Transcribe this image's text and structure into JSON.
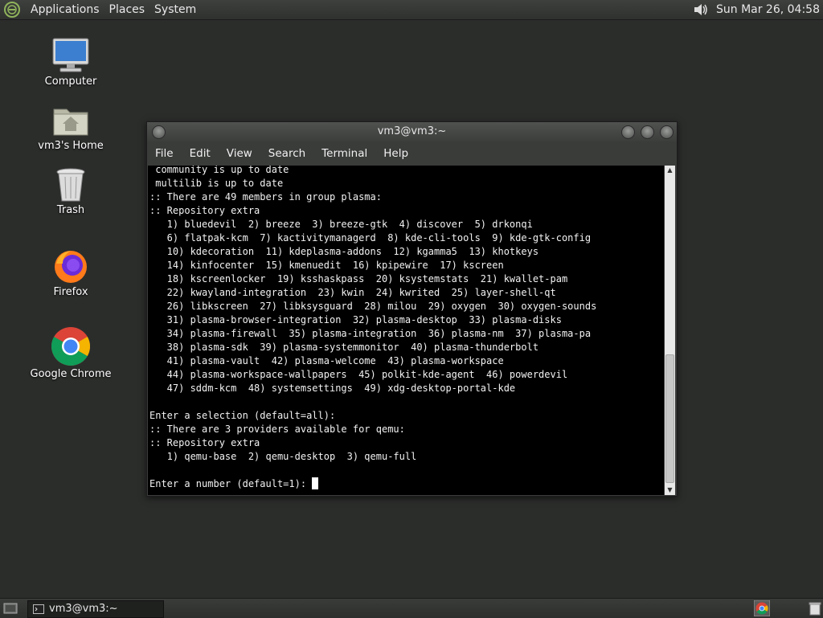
{
  "top_panel": {
    "menus": [
      "Applications",
      "Places",
      "System"
    ],
    "clock": "Sun Mar 26, 04:58",
    "icons": [
      "mate-logo-icon",
      "volume-icon"
    ]
  },
  "desktop": {
    "icons": [
      {
        "label": "Computer",
        "icon": "computer-icon"
      },
      {
        "label": "vm3's Home",
        "icon": "home-folder-icon"
      },
      {
        "label": "Trash",
        "icon": "trash-icon"
      },
      {
        "label": "Firefox",
        "icon": "firefox-icon"
      },
      {
        "label": "Google Chrome",
        "icon": "chrome-icon"
      }
    ]
  },
  "terminal": {
    "title": "vm3@vm3:~",
    "menu": [
      "File",
      "Edit",
      "View",
      "Search",
      "Terminal",
      "Help"
    ],
    "lines": [
      " community is up to date",
      " multilib is up to date",
      ":: There are 49 members in group plasma:",
      ":: Repository extra",
      "   1) bluedevil  2) breeze  3) breeze-gtk  4) discover  5) drkonqi",
      "   6) flatpak-kcm  7) kactivitymanagerd  8) kde-cli-tools  9) kde-gtk-config",
      "   10) kdecoration  11) kdeplasma-addons  12) kgamma5  13) khotkeys",
      "   14) kinfocenter  15) kmenuedit  16) kpipewire  17) kscreen",
      "   18) kscreenlocker  19) ksshaskpass  20) ksystemstats  21) kwallet-pam",
      "   22) kwayland-integration  23) kwin  24) kwrited  25) layer-shell-qt",
      "   26) libkscreen  27) libksysguard  28) milou  29) oxygen  30) oxygen-sounds",
      "   31) plasma-browser-integration  32) plasma-desktop  33) plasma-disks",
      "   34) plasma-firewall  35) plasma-integration  36) plasma-nm  37) plasma-pa",
      "   38) plasma-sdk  39) plasma-systemmonitor  40) plasma-thunderbolt",
      "   41) plasma-vault  42) plasma-welcome  43) plasma-workspace",
      "   44) plasma-workspace-wallpapers  45) polkit-kde-agent  46) powerdevil",
      "   47) sddm-kcm  48) systemsettings  49) xdg-desktop-portal-kde",
      "",
      "Enter a selection (default=all):",
      ":: There are 3 providers available for qemu:",
      ":: Repository extra",
      "   1) qemu-base  2) qemu-desktop  3) qemu-full",
      ""
    ],
    "prompt": "Enter a number (default=1): "
  },
  "bottom_panel": {
    "task_label": "vm3@vm3:~"
  }
}
